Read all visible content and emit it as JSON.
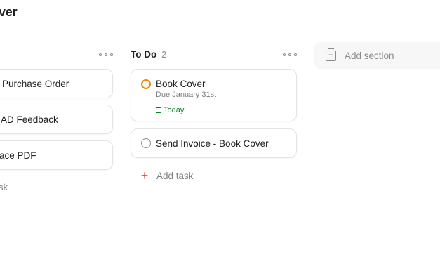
{
  "project": {
    "title": "ver"
  },
  "left_column": {
    "cards": [
      {
        "text": "Purchase Order"
      },
      {
        "text": "AD Feedback"
      },
      {
        "text": "ace PDF"
      }
    ],
    "add_task_label": "sk"
  },
  "todo_column": {
    "title": "To Do",
    "count": "2",
    "tasks": [
      {
        "title": "Book Cover",
        "due": "Due January 31st",
        "date_label": "Today",
        "priority_color": "#eb8909"
      },
      {
        "title": "Send Invoice - Book Cover"
      }
    ],
    "add_task_label": "Add task"
  },
  "add_section": {
    "label": "Add section"
  },
  "icons": {
    "more": "more-horizontal-icon",
    "checkbox": "circle-checkbox-icon",
    "calendar": "calendar-icon",
    "plus": "plus-icon",
    "add_section": "add-section-icon"
  },
  "colors": {
    "accent_red": "#dc4c3e",
    "today_green": "#058527",
    "priority_orange": "#eb8909"
  }
}
